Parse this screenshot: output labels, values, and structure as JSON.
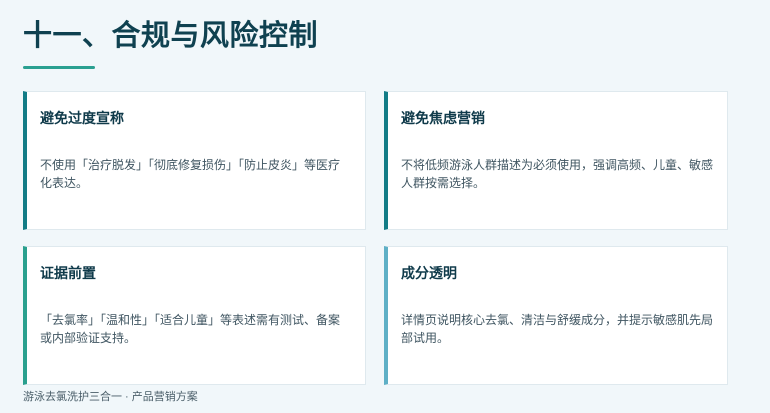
{
  "page": {
    "title": "十一、合规与风险控制",
    "footer": "游泳去氯洗护三合一 · 产品营销方案"
  },
  "cards": [
    {
      "title": "避免过度宣称",
      "body": "不使用「治疗脱发」「彻底修复损伤」「防止皮炎」等医疗化表达。",
      "accent": "#137c86"
    },
    {
      "title": "避免焦虑营销",
      "body": "不将低频游泳人群描述为必须使用，强调高频、儿童、敏感人群按需选择。",
      "accent": "#137c86"
    },
    {
      "title": "证据前置",
      "body": "「去氯率」「温和性」「适合儿童」等表述需有测试、备案或内部验证支持。",
      "accent": "#2aa08e"
    },
    {
      "title": "成分透明",
      "body": "详情页说明核心去氯、清洁与舒缓成分，并提示敏感肌先局部试用。",
      "accent": "#5fb0c6"
    }
  ],
  "colors": {
    "background": "#f1f7fa",
    "title": "#0f4150",
    "underline": "#2aa091"
  }
}
